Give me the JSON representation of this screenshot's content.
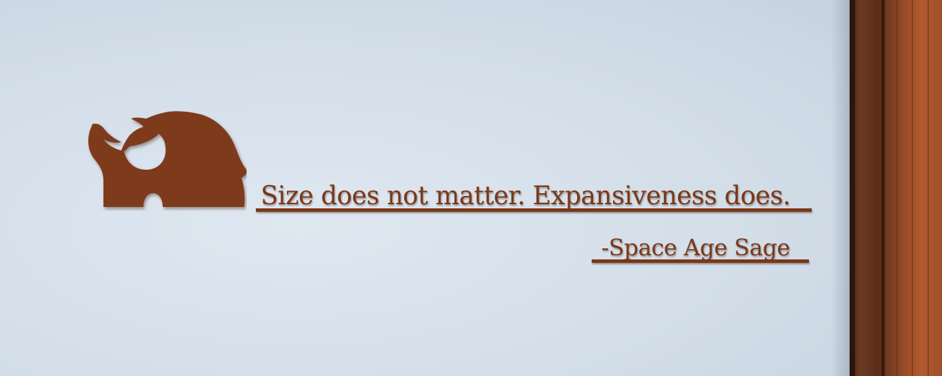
{
  "sign": {
    "quote": "Size does not matter. Expansiveness does.",
    "attribution": "-Space Age Sage",
    "logo_icon": "mammoth-icon"
  },
  "colors": {
    "wall": "#d2dde8",
    "wood_sign": "#7a3818",
    "door_frame": "#8a4424"
  }
}
